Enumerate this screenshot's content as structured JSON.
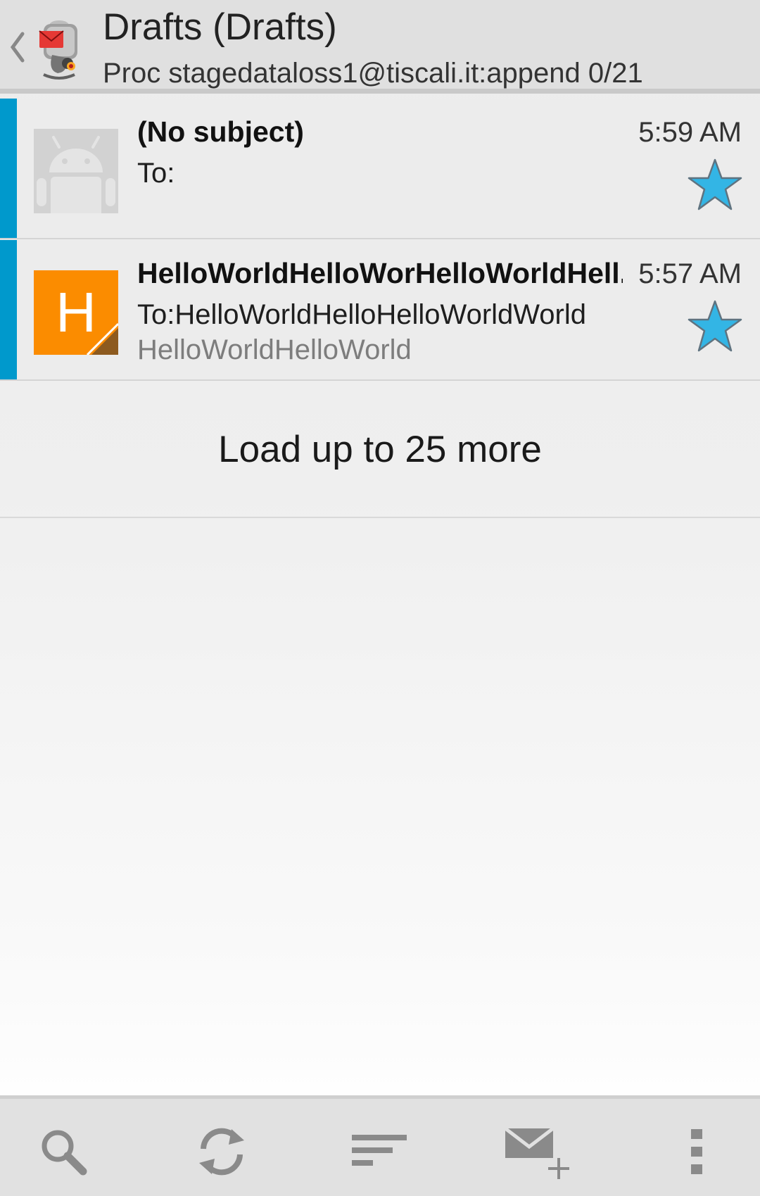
{
  "header": {
    "title": "Drafts (Drafts)",
    "subtitle": "Proc stagedataloss1@tiscali.it:append 0/21",
    "back_icon": "chevron-left-icon",
    "logo_icon": "k9-mail-robot-logo"
  },
  "messages": [
    {
      "subject": "(No subject)",
      "to": "To:",
      "preview": "",
      "time": "5:59 AM",
      "starred": true,
      "avatar": "android-default-avatar"
    },
    {
      "subject": "HelloWorldHelloWorHelloWorldHell..",
      "to": "To:HelloWorldHelloHelloWorldWorld",
      "preview": "HelloWorldHelloWorld",
      "time": "5:57 AM",
      "starred": true,
      "avatar_letter": "H"
    }
  ],
  "load_more": {
    "label": "Load up to 25 more"
  },
  "toolbar": {
    "items": [
      "search-icon",
      "refresh-icon",
      "sort-icon",
      "compose-icon",
      "overflow-menu-icon"
    ]
  },
  "colors": {
    "accent": "#0099cc",
    "star": "#33b5e5",
    "avatar_orange": "#fb8c00",
    "avatar_corner": "#8d5a1f",
    "toolbar_bg": "#e1e1e1",
    "icon_gray": "#8a8a8a"
  }
}
